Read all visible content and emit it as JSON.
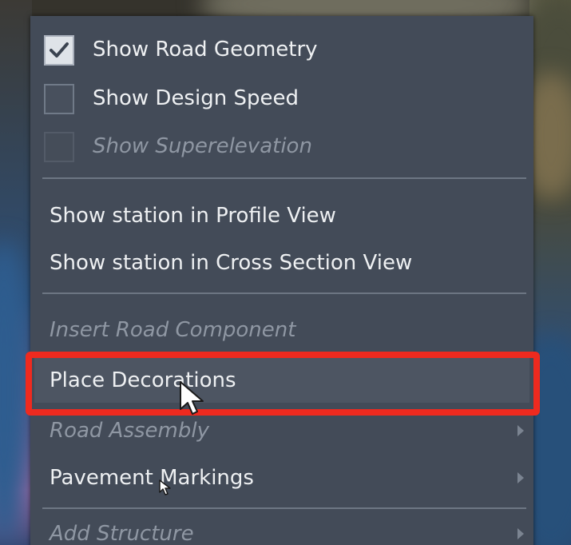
{
  "menu": {
    "items": [
      {
        "label": "Show Road Geometry",
        "type": "checkbox",
        "checked": true,
        "enabled": true
      },
      {
        "label": "Show Design Speed",
        "type": "checkbox",
        "checked": false,
        "enabled": true
      },
      {
        "label": "Show Superelevation",
        "type": "checkbox",
        "checked": false,
        "enabled": false
      },
      {
        "label": "Show station in Profile View",
        "type": "action",
        "enabled": true
      },
      {
        "label": "Show station in Cross Section View",
        "type": "action",
        "enabled": true
      },
      {
        "label": "Insert Road Component",
        "type": "action",
        "enabled": false
      },
      {
        "label": "Place Decorations",
        "type": "action",
        "enabled": true,
        "hovered": true
      },
      {
        "label": "Road Assembly",
        "type": "submenu",
        "enabled": false
      },
      {
        "label": "Pavement Markings",
        "type": "submenu",
        "enabled": true
      },
      {
        "label": "Add Structure",
        "type": "submenu",
        "enabled": false
      }
    ]
  },
  "annotation": {
    "type": "highlight-box",
    "target": "Place Decorations",
    "color": "#ee2a1f"
  },
  "colors": {
    "menu_bg": "#434b58",
    "text": "#eef0f2",
    "disabled_text": "#8f97a3",
    "separator": "#6d7683",
    "callout": "#ee2a1f"
  },
  "icons": {
    "check": "check-icon",
    "submenu": "chevron-right-icon",
    "pointer": "mouse-pointer-icon"
  }
}
